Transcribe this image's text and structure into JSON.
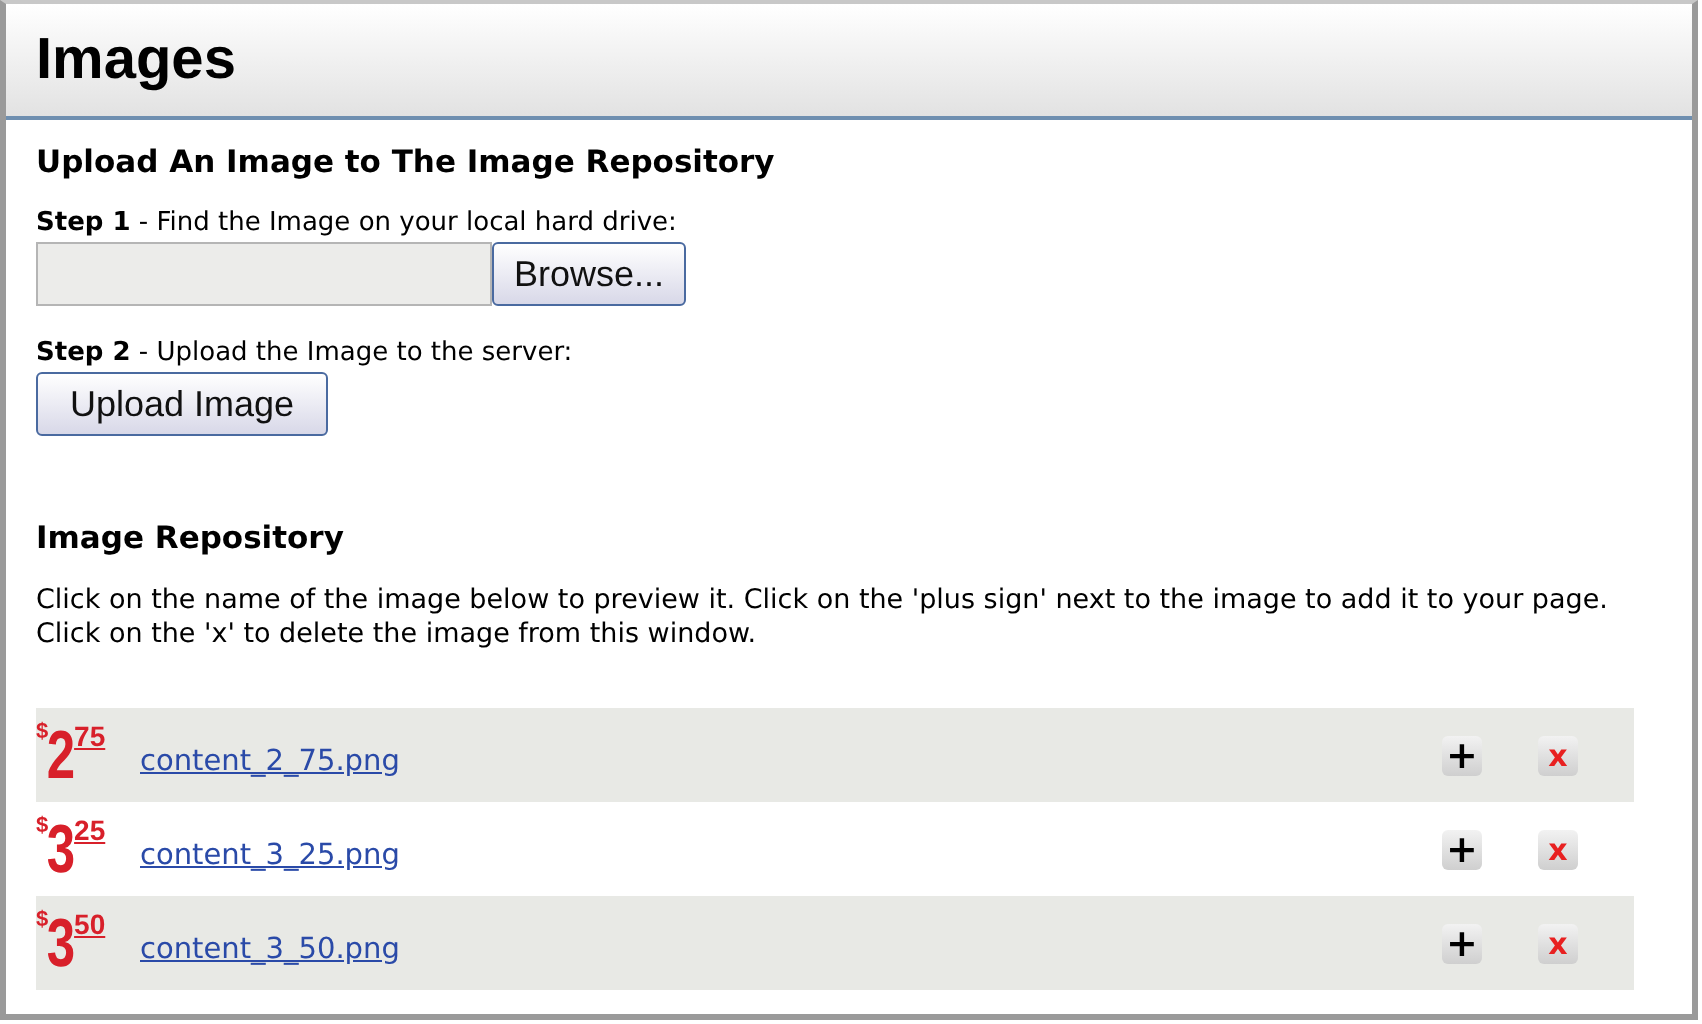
{
  "title": "Images",
  "upload": {
    "heading": "Upload An Image to The Image Repository",
    "step1": {
      "label": "Step 1",
      "text": " - Find the Image on your local hard drive:",
      "button": "Browse..."
    },
    "step2": {
      "label": "Step 2",
      "text": " - Upload the Image to the server:",
      "button": "Upload Image"
    }
  },
  "repository": {
    "heading": "Image Repository",
    "intro": "Click on the name of the image below to preview it. Click on the 'plus sign' next to the image to add it to your page. Click on the 'x' to delete the image from this window.",
    "rows": [
      {
        "currency": "$",
        "dollars": "2",
        "cents": "75",
        "name": "content_2_75.png",
        "add": "+",
        "delete": "x"
      },
      {
        "currency": "$",
        "dollars": "3",
        "cents": "25",
        "name": "content_3_25.png",
        "add": "+",
        "delete": "x"
      },
      {
        "currency": "$",
        "dollars": "3",
        "cents": "50",
        "name": "content_3_50.png",
        "add": "+",
        "delete": "x"
      }
    ]
  }
}
